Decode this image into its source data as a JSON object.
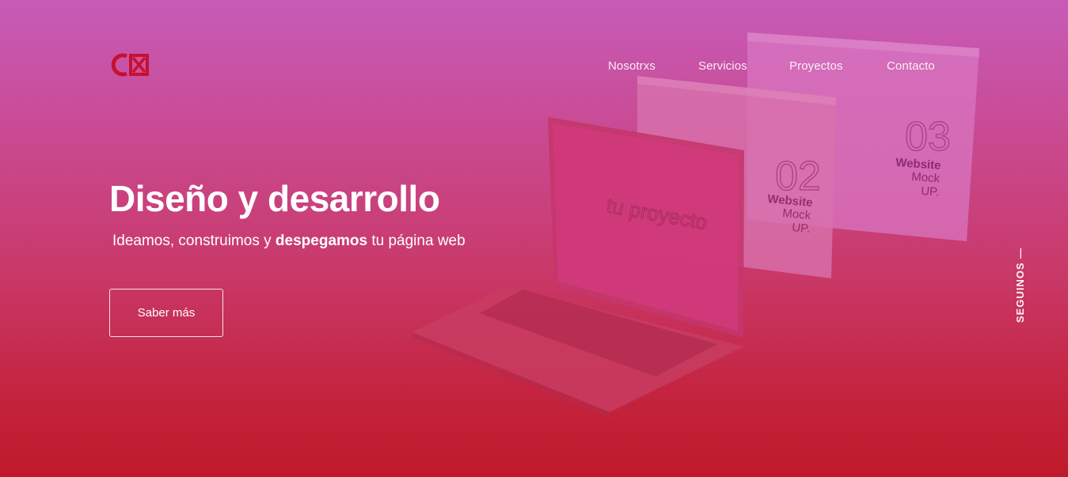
{
  "brand": {
    "logo_text": "CX",
    "logo_color": "#c8102e"
  },
  "nav": {
    "items": [
      {
        "label": "Nosotrxs"
      },
      {
        "label": "Servicios"
      },
      {
        "label": "Proyectos"
      },
      {
        "label": "Contacto"
      }
    ]
  },
  "hero": {
    "title": "Diseño y desarrollo",
    "subtitle_part1": "Ideamos, construimos y ",
    "subtitle_bold": "despegamos",
    "subtitle_part2": " tu página web",
    "cta_label": "Saber más"
  },
  "illustration": {
    "laptop_screen_text": "tu proyecto",
    "card_02": {
      "number": "02",
      "line1": "Website",
      "line2": "Mock",
      "line3": "UP."
    },
    "card_03": {
      "number": "03",
      "line1": "Website",
      "line2": "Mock",
      "line3": "UP."
    }
  },
  "social": {
    "label": "SEGUINOS —"
  },
  "colors": {
    "gradient_top": "#c75bb8",
    "gradient_bottom": "#bf1a2a"
  }
}
